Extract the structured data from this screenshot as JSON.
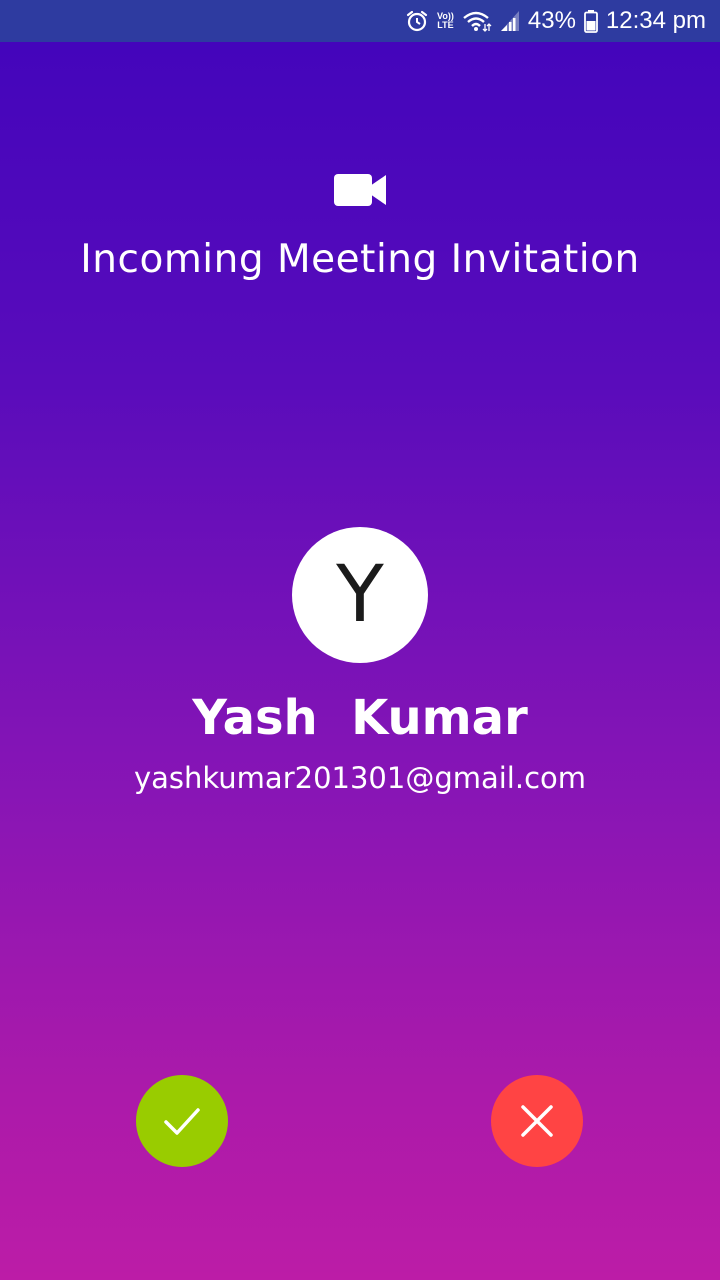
{
  "status_bar": {
    "volte_top": "Vo))",
    "volte_bottom": "LTE",
    "battery_percent": "43%",
    "time": "12:34 pm",
    "icons": [
      "alarm-icon",
      "volte-icon",
      "wifi-icon",
      "signal-icon",
      "battery-icon"
    ],
    "background_color": "#2e3ba0"
  },
  "header": {
    "icon": "video-camera-icon",
    "title": "Incoming Meeting Invitation"
  },
  "caller": {
    "avatar_letter": "Y",
    "name": "Yash  Kumar",
    "email": "yashkumar201301@gmail.com"
  },
  "actions": {
    "accept": {
      "icon": "check-icon",
      "color": "#99cc00"
    },
    "decline": {
      "icon": "close-icon",
      "color": "#ff4444"
    }
  },
  "colors": {
    "gradient_top": "#4104bb",
    "gradient_bottom": "#bc1ca7",
    "text": "#ffffff"
  }
}
